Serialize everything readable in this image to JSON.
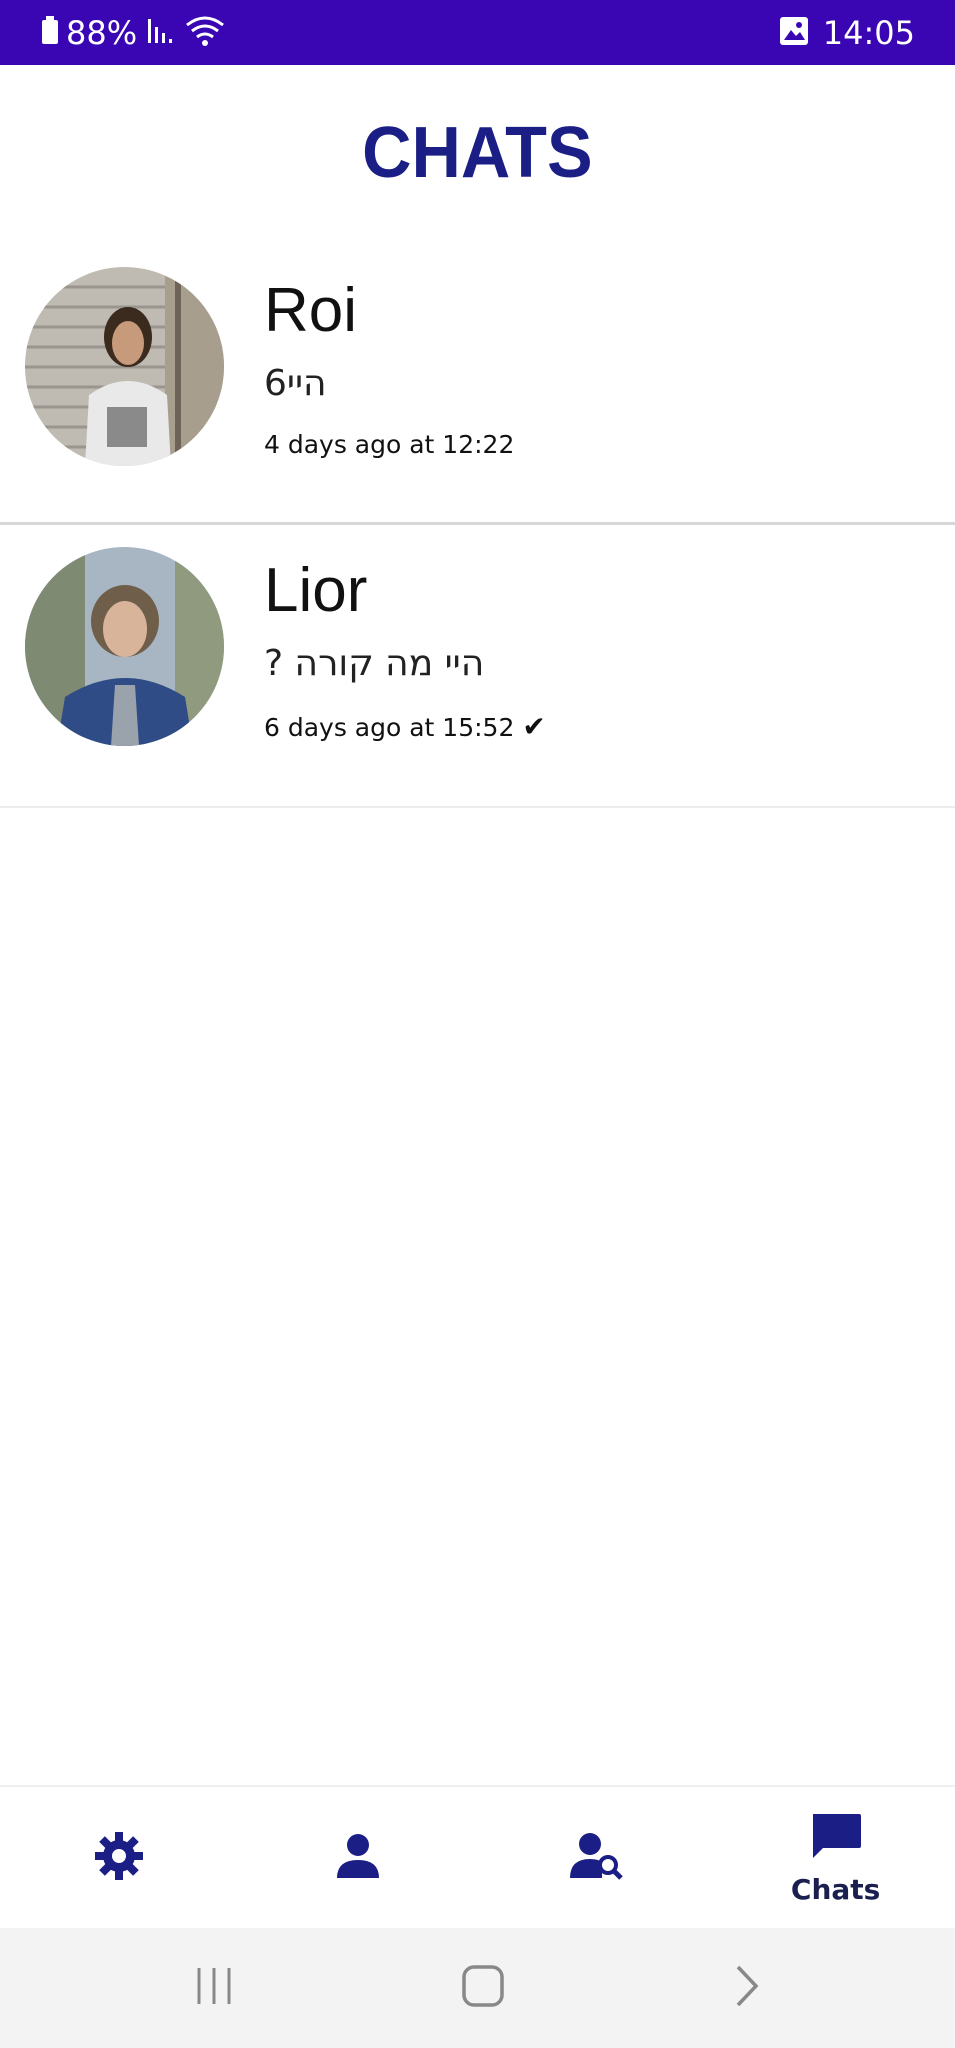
{
  "status_bar": {
    "battery_percent": "88%",
    "time": "14:05"
  },
  "header": {
    "title": "CHATS"
  },
  "chats": [
    {
      "name": "Roi",
      "last_message": "היי6",
      "timestamp": "4 days ago at 12:22",
      "read_mark": ""
    },
    {
      "name": "Lior",
      "last_message": "היי מה קורה ?",
      "timestamp": "6 days ago at 15:52",
      "read_mark": "✔"
    }
  ],
  "bottom_nav": {
    "items": [
      {
        "icon": "gear-icon",
        "label": ""
      },
      {
        "icon": "person-icon",
        "label": ""
      },
      {
        "icon": "person-search-icon",
        "label": ""
      },
      {
        "icon": "chat-bubble-icon",
        "label": "Chats"
      }
    ]
  },
  "colors": {
    "status_bar_bg": "#3a06b3",
    "brand_navy": "#1b1f85"
  }
}
